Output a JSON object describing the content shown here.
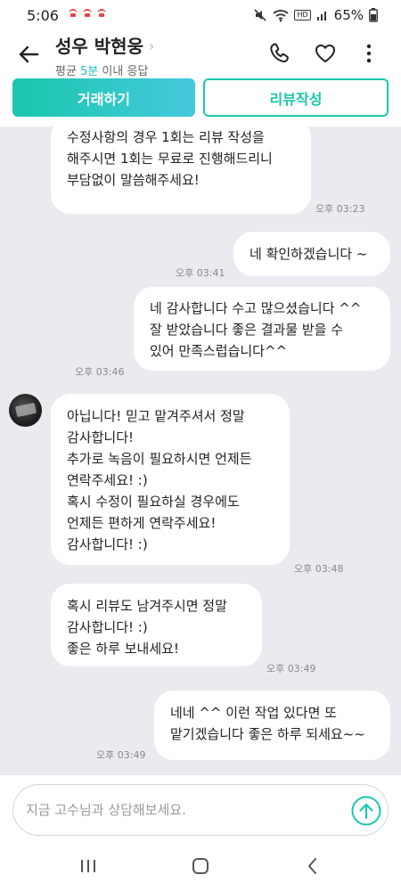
{
  "status": {
    "time": "5:06",
    "battery": "65%",
    "hd_label": "HD"
  },
  "header": {
    "title": "성우 박현웅",
    "subtitle_prefix": "평균 ",
    "subtitle_accent": "5분",
    "subtitle_suffix": " 이내 응답"
  },
  "actions": {
    "deal_label": "거래하기",
    "review_label": "리뷰작성"
  },
  "messages": [
    {
      "text": "수정사항의 경우 1회는 리뷰 작성을\n해주시면 1회는 무료로 진행해드리니\n부담없이 말씀해주세요!",
      "time": "오후 03:23"
    },
    {
      "text": "네 확인하겠습니다 ~",
      "time": "오후 03:41"
    },
    {
      "text": "네 감사합니다 수고 많으셨습니다 ^^\n잘 받았습니다 좋은 결과물 받을 수\n있어 만족스럽습니다^^",
      "time": "오후 03:46"
    },
    {
      "text": "아닙니다! 믿고 맡겨주셔서 정말\n감사합니다!\n추가로 녹음이 필요하시면 언제든\n연락주세요! :)\n혹시 수정이 필요하실 경우에도\n언제든 편하게 연락주세요!\n감사합니다! :)",
      "time": "오후 03:48"
    },
    {
      "text": "혹시 리뷰도 남겨주시면 정말\n감사합니다! :)\n좋은 하루 보내세요!",
      "time": "오후 03:49"
    },
    {
      "text": "네네 ^^ 이런 작업 있다면 또\n맡기겠습니다 좋은 하루 되세요~~",
      "time": "오후 03:49"
    }
  ],
  "input": {
    "placeholder": "지금 고수님과 상담해보세요."
  },
  "icons": {
    "back": "arrow-left-icon",
    "call": "phone-icon",
    "like": "heart-icon",
    "more": "more-vertical-icon",
    "send": "arrow-up-circle-icon",
    "nav_recent": "recent-apps-icon",
    "nav_home": "home-icon",
    "nav_back": "nav-back-icon"
  },
  "colors": {
    "accent": "#1ac7ad",
    "accent_gradient_end": "#45c8dd",
    "chat_bg": "#e9ebef",
    "notification": "#e64545"
  }
}
